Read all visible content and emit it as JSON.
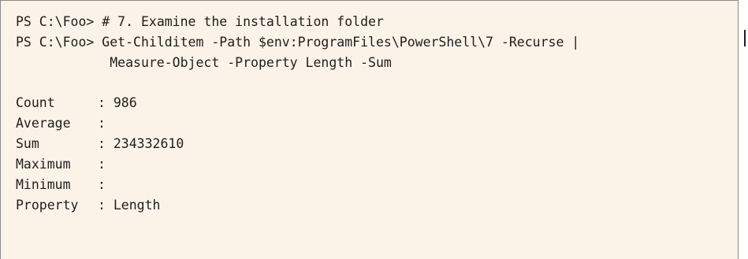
{
  "session": {
    "prompt": "PS C:\\Foo>",
    "comment_command": "# 7. Examine the installation folder",
    "command_line_1": "Get-Childitem -Path $env:ProgramFiles\\PowerShell\\7 -Recurse |",
    "command_line_2": "            Measure-Object -Property Length -Sum"
  },
  "output": {
    "rows": [
      {
        "label": "Count",
        "value": ": 986"
      },
      {
        "label": "Average",
        "value": ":"
      },
      {
        "label": "Sum",
        "value": ": 234332610"
      },
      {
        "label": "Maximum",
        "value": ":"
      },
      {
        "label": "Minimum",
        "value": ":"
      },
      {
        "label": "Property",
        "value": ": Length"
      }
    ]
  }
}
